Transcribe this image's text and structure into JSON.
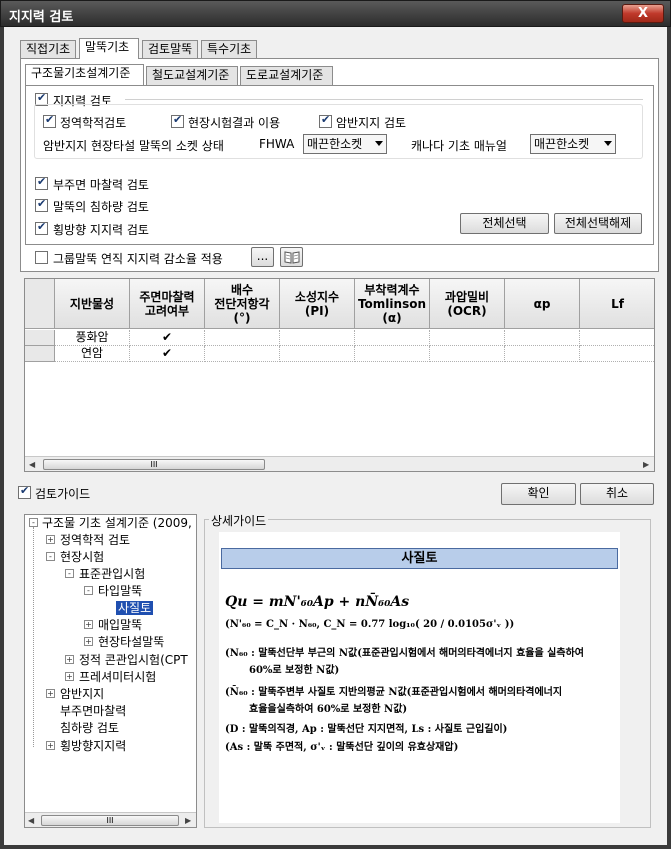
{
  "window": {
    "title": "지지력 검토",
    "close_label": "X"
  },
  "main_tabs": [
    "직접기초",
    "말뚝기초",
    "검토말뚝",
    "특수기초"
  ],
  "sub_tabs": [
    "구조물기초설계기준",
    "철도교설계기준",
    "도로교설계기준"
  ],
  "options": {
    "bearing_check": "지지력 검토",
    "static_check": "정역학적검토",
    "field_result": "현장시험결과 이용",
    "rock_check": "암반지지 검토",
    "socket_label": "암반지지 현장타설 말뚝의 소켓 상태",
    "fhwa_label": "FHWA",
    "fhwa_value": "매끈한소켓",
    "canada_label": "캐나다 기초 매뉴얼",
    "canada_value": "매끈한소켓",
    "negative_friction": "부주면 마찰력 검토",
    "settlement": "말뚝의 침하량 검토",
    "lateral": "횡방향 지지력 검토",
    "select_all": "전체선택",
    "deselect_all": "전체선택해제",
    "group_reduction": "그룹말뚝 연직 지지력 감소율 적용",
    "dots_label": "..."
  },
  "grid": {
    "headers": [
      {
        "l1": "지반물성",
        "l2": "",
        "l3": ""
      },
      {
        "l1": "주면마찰력",
        "l2": "고려여부",
        "l3": ""
      },
      {
        "l1": "배수",
        "l2": "전단저항각",
        "l3": "(°)"
      },
      {
        "l1": "소성지수",
        "l2": "(PI)",
        "l3": ""
      },
      {
        "l1": "부착력계수",
        "l2": "Tomlinson",
        "l3": "(α)"
      },
      {
        "l1": "과압밀비",
        "l2": "(OCR)",
        "l3": ""
      },
      {
        "l1": "αp",
        "l2": "",
        "l3": ""
      },
      {
        "l1": "Lf",
        "l2": "",
        "l3": ""
      }
    ],
    "rows": [
      {
        "name": "풍화암",
        "friction": "✔"
      },
      {
        "name": "연암",
        "friction": "✔"
      }
    ],
    "scroll_grip": "III"
  },
  "guide": {
    "toggle_label": "검토가이드",
    "ok_label": "확인",
    "cancel_label": "취소",
    "detail_label": "상세가이드",
    "tree_grip": "III",
    "tree": [
      {
        "label": "구조물 기초 설계기준 (2009,",
        "sign": "-"
      },
      {
        "label": "정역학적 검토",
        "sign": "+"
      },
      {
        "label": "현장시험",
        "sign": "-"
      },
      {
        "label": "표준관입시험",
        "sign": "-"
      },
      {
        "label": "타입말뚝",
        "sign": "-"
      },
      {
        "label": "사질토",
        "sign": ""
      },
      {
        "label": "매입말뚝",
        "sign": "+"
      },
      {
        "label": "현장타설말뚝",
        "sign": "+"
      },
      {
        "label": "정적 콘관입시험(CPT",
        "sign": "+"
      },
      {
        "label": "프레셔미터시험",
        "sign": "+"
      },
      {
        "label": "암반지지",
        "sign": "+"
      },
      {
        "label": "부주면마찰력",
        "sign": ""
      },
      {
        "label": "침하량 검토",
        "sign": ""
      },
      {
        "label": "횡방향지지력",
        "sign": "+"
      }
    ],
    "doc": {
      "heading": "사질토",
      "formula": "Qu = mN'₆₀Ap + nN̄₆₀As",
      "line1": "(N'₆₀ = C_N · N₆₀,  C_N = 0.77 log₁₀( 20 / 0.0105σ'ᵥ ))",
      "line2a": "(N₆₀ : 말뚝선단부 부근의 N값(표준관입시험에서 해머의타격에너지 효율을 실측하여",
      "line2b": "60%로 보정한 N값)",
      "line3a": "(N̄₆₀ : 말뚝주변부 사질토 지반의평균 N값(표준관입시험에서 해머의타격에너지",
      "line3b": "효율을실측하여 60%로 보정한 N값)",
      "line4": "(D : 말뚝의직경, Ap : 말뚝선단 지지면적, Ls : 사질토 근입길이)",
      "line5": "(As : 말뚝 주면적, σ'ᵥ : 말뚝선단 깊이의 유효상재압)"
    }
  }
}
